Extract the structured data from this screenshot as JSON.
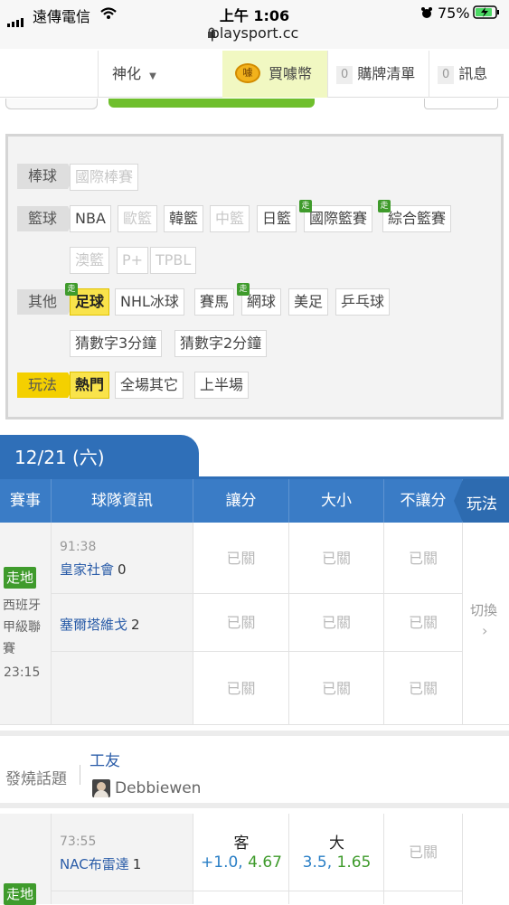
{
  "status_bar": {
    "carrier": "遠傳電信",
    "time": "上午 1:06",
    "url": "playsport.cc",
    "battery": "75%"
  },
  "nav": {
    "user": "神化",
    "buy": "買噱幣",
    "buy_icon_text": "噱",
    "list_count": "0",
    "list_label": "購牌清單",
    "msg_count": "0",
    "msg_label": "訊息"
  },
  "filters": {
    "rows": [
      {
        "category": "棒球",
        "chips": [
          "國際棒賽"
        ]
      },
      {
        "category": "籃球",
        "chips": [
          "NBA",
          "歐籃",
          "韓籃",
          "中籃",
          "日籃",
          "國際籃賽",
          "綜合籃賽",
          "澳籃",
          "P+",
          "TPBL"
        ]
      },
      {
        "category": "其他",
        "chips": [
          "足球",
          "NHL冰球",
          "賽馬",
          "網球",
          "美足",
          "乒乓球",
          "猜數字3分鐘",
          "猜數字2分鐘"
        ]
      },
      {
        "category": "玩法",
        "chips": [
          "熱門",
          "全場其它",
          "上半場"
        ]
      }
    ],
    "live_badge": "走"
  },
  "date_header": "12/21 (六)",
  "table": {
    "headers": [
      "賽事",
      "球隊資訊",
      "讓分",
      "大小",
      "不讓分",
      "玩法"
    ],
    "closed_label": "已關",
    "switch_label": "切換",
    "match1": {
      "live_label": "走地",
      "league": "西班牙甲級聯賽",
      "start_time": "23:15",
      "clock": "91:38",
      "home_team": "皇家社會",
      "home_score": "0",
      "away_team": "塞爾塔維戈",
      "away_score": "2"
    },
    "match2": {
      "live_label": "走地",
      "clock": "73:55",
      "team": "NAC布雷達",
      "score": "1",
      "spread_side": "客",
      "spread_line": "+1.0",
      "spread_odds": "4.67",
      "total_side": "大",
      "total_line": "3.5",
      "total_odds": "1.65"
    }
  },
  "hot_topic": {
    "label": "發燒話題",
    "title": "工友",
    "author": "Debbiewen"
  },
  "colors": {
    "header_blue": "#3a7cc6",
    "live_green": "#3f9b2c",
    "highlight_yellow": "#f9e34b",
    "team_link": "#2a5ca8"
  }
}
